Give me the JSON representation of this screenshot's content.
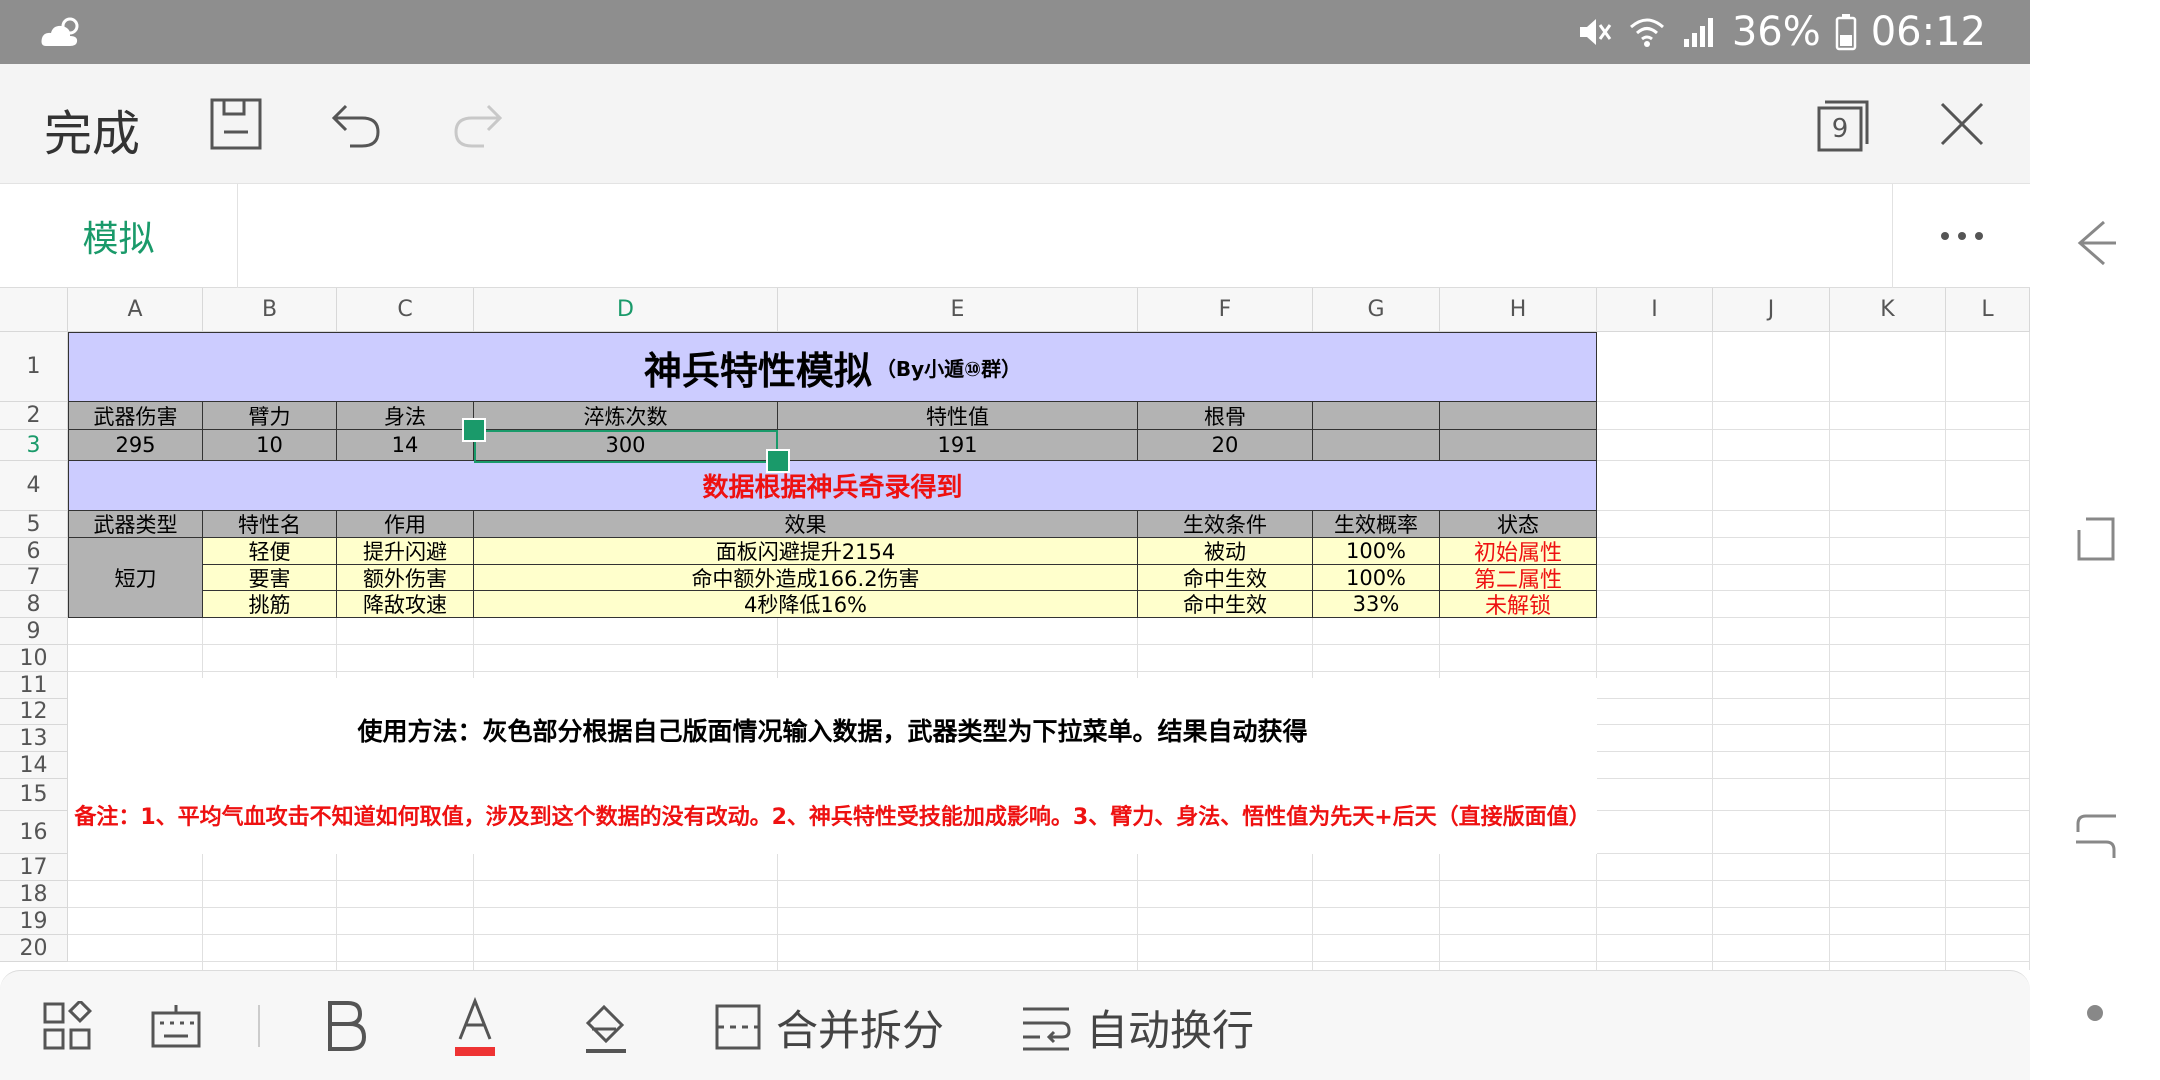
{
  "status": {
    "battery_percent": "36%",
    "time": "06:12"
  },
  "toolbar": {
    "done_label": "完成",
    "window_count": "9"
  },
  "tab": {
    "label": "模拟"
  },
  "columns": [
    "A",
    "B",
    "C",
    "D",
    "E",
    "F",
    "G",
    "H",
    "I",
    "J",
    "K",
    "L"
  ],
  "rows": [
    "1",
    "2",
    "3",
    "4",
    "5",
    "6",
    "7",
    "8",
    "9",
    "10",
    "11",
    "12",
    "13",
    "14",
    "15",
    "16",
    "17",
    "18",
    "19",
    "20"
  ],
  "sheet": {
    "title_main": "神兵特性模拟",
    "title_sub": "（By小遁⑩群）",
    "stats_headers": [
      "武器伤害",
      "臂力",
      "身法",
      "淬炼次数",
      "特性值",
      "根骨"
    ],
    "stats_values": [
      "295",
      "10",
      "14",
      "300",
      "191",
      "20"
    ],
    "source_note": "数据根据神兵奇录得到",
    "table_headers": [
      "武器类型",
      "特性名",
      "作用",
      "效果",
      "生效条件",
      "生效概率",
      "状态"
    ],
    "weapon_type": "短刀",
    "traits": [
      {
        "name": "轻便",
        "role": "提升闪避",
        "effect": "面板闪避提升2154",
        "condition": "被动",
        "rate": "100%",
        "state": "初始属性"
      },
      {
        "name": "要害",
        "role": "额外伤害",
        "effect": "命中额外造成166.2伤害",
        "condition": "命中生效",
        "rate": "100%",
        "state": "第二属性"
      },
      {
        "name": "挑筋",
        "role": "降敌攻速",
        "effect": "4秒降低16%",
        "condition": "命中生效",
        "rate": "33%",
        "state": "未解锁"
      }
    ],
    "usage": "使用方法：灰色部分根据自己版面情况输入数据，武器类型为下拉菜单。结果自动获得",
    "remark": "备注：1、平均气血攻击不知道如何取值，涉及到这个数据的没有改动。2、神兵特性受技能加成影响。3、臂力、身法、悟性值为先天+后天（直接版面值）"
  },
  "bottombar": {
    "merge_label": "合并拆分",
    "wrap_label": "自动换行"
  },
  "colors": {
    "accent": "#1a9a6a",
    "purple": "#ccccff",
    "gray": "#b3b3b3",
    "yellow": "#ffffcc",
    "red": "#ee1111"
  }
}
